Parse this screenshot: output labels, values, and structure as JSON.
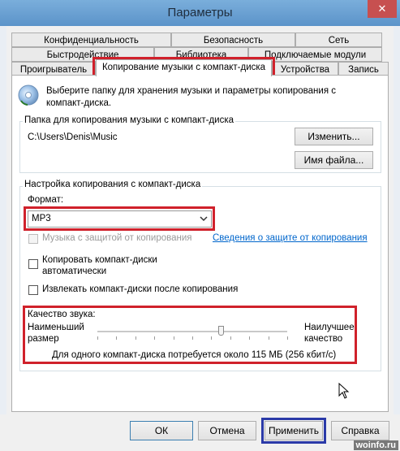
{
  "window": {
    "title": "Параметры",
    "close_glyph": "✕"
  },
  "tabs": {
    "row1": [
      "Конфиденциальность",
      "Безопасность",
      "Сеть"
    ],
    "row2": [
      "Быстродействие",
      "Библиотека",
      "Подключаемые модули"
    ],
    "row3": [
      "Проигрыватель",
      "Копирование музыки с компакт-диска",
      "Устройства",
      "Запись"
    ],
    "active": "Копирование музыки с компакт-диска"
  },
  "intro": {
    "text_line1": "Выберите папку для хранения музыки и параметры копирования с",
    "text_line2": "компакт-диска."
  },
  "folder_group": {
    "title": "Папка для копирования музыки с компакт-диска",
    "path": "C:\\Users\\Denis\\Music",
    "change_button": "Изменить...",
    "filename_button": "Имя файла..."
  },
  "rip_group": {
    "title": "Настройка копирования с компакт-диска",
    "format_label": "Формат:",
    "format_value": "MP3",
    "copy_protect_label": "Музыка с защитой от копирования",
    "copy_protect_link": "Сведения о защите от копирования",
    "auto_rip_line1": "Копировать компакт-диски",
    "auto_rip_line2": "автоматически",
    "eject_label": "Извлекать компакт-диски после копирования",
    "quality_label": "Качество звука:",
    "min_label_line1": "Наименьший",
    "min_label_line2": "размер",
    "max_label_line1": "Наилучшее",
    "max_label_line2": "качество",
    "size_info": "Для одного компакт-диска потребуется около   115 МБ (256 кбит/с)",
    "quality_level": 0.65
  },
  "buttons": {
    "ok": "ОК",
    "cancel": "Отмена",
    "apply": "Применить",
    "help": "Справка"
  },
  "watermark": "woinfo.ru",
  "colors": {
    "highlight_red": "#d0212b",
    "highlight_blue": "#2b3aa8",
    "link": "#0066cc"
  }
}
